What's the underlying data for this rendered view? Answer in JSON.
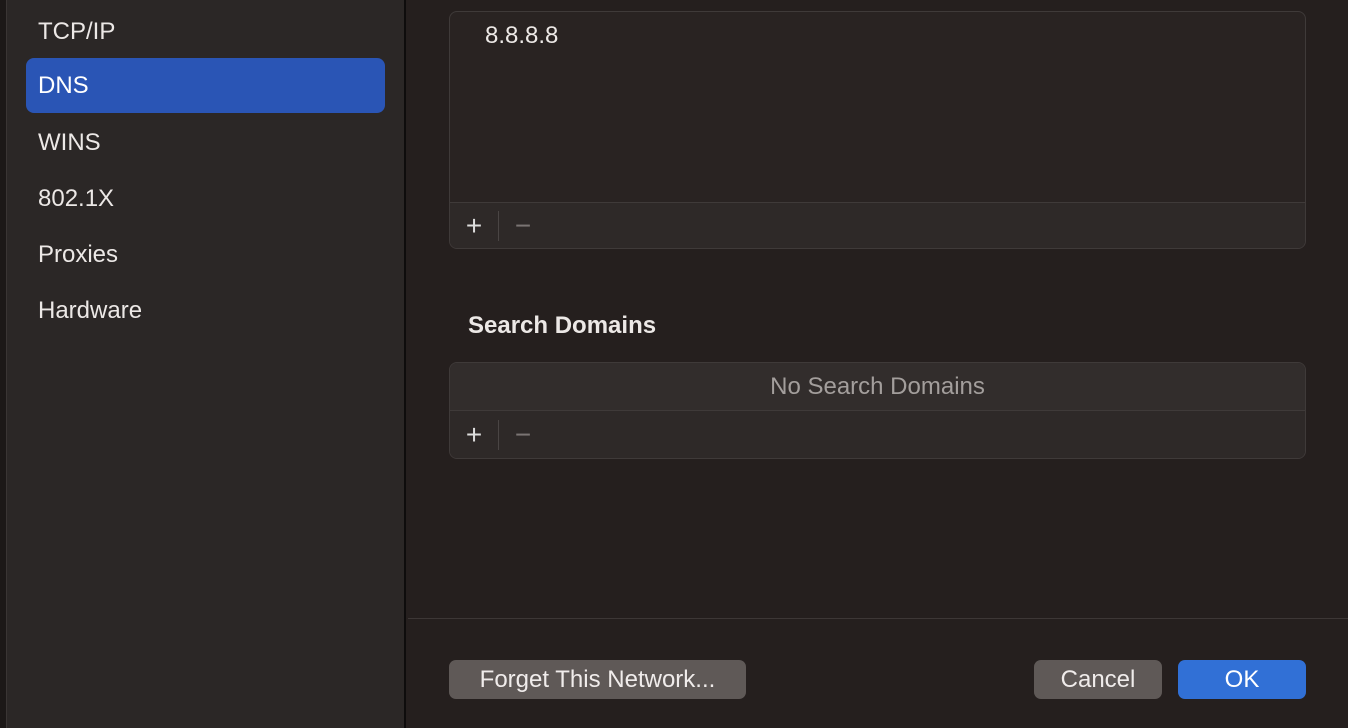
{
  "sidebar": {
    "items": [
      {
        "label": "TCP/IP",
        "selected": false
      },
      {
        "label": "DNS",
        "selected": true
      },
      {
        "label": "WINS",
        "selected": false
      },
      {
        "label": "802.1X",
        "selected": false
      },
      {
        "label": "Proxies",
        "selected": false
      },
      {
        "label": "Hardware",
        "selected": false
      }
    ]
  },
  "dns_servers": {
    "entries": [
      "8.8.8.8"
    ],
    "add": "+",
    "remove": "−"
  },
  "search_domains": {
    "title": "Search Domains",
    "empty": "No Search Domains",
    "add": "+",
    "remove": "−"
  },
  "footer": {
    "forget": "Forget This Network...",
    "cancel": "Cancel",
    "ok": "OK"
  },
  "colors": {
    "accent": "#2a55b5",
    "ok": "#3170d6"
  }
}
